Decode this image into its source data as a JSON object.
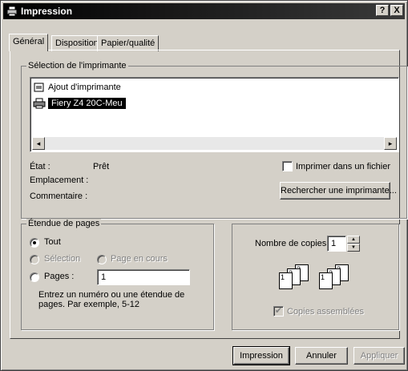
{
  "window": {
    "title": "Impression",
    "help_btn": "?",
    "close_btn": "X"
  },
  "tabs": [
    {
      "label": "Général"
    },
    {
      "label": "Disposition"
    },
    {
      "label": "Papier/qualité"
    }
  ],
  "printer_section": {
    "title": "Sélection de l'imprimante",
    "printers": [
      {
        "name": "Ajout d'imprimante"
      },
      {
        "name": "Fiery Z4 20C-Meu"
      }
    ],
    "status_label": "État :",
    "status_value": "Prêt",
    "location_label": "Emplacement :",
    "comment_label": "Commentaire :",
    "print_to_file_label": "Imprimer dans un fichier",
    "find_printer_label": "Rechercher une imprimante..."
  },
  "page_range": {
    "title": "Étendue de pages",
    "all_label": "Tout",
    "selection_label": "Sélection",
    "current_page_label": "Page en cours",
    "pages_label": "Pages :",
    "pages_value": "1",
    "hint": "Entrez un numéro ou une étendue de pages. Par exemple, 5-12"
  },
  "copies": {
    "count_label": "Nombre de copies :",
    "count_value": "1",
    "collate_label": "Copies assemblées",
    "page_numbers": [
      "1",
      "2",
      "3"
    ]
  },
  "buttons": {
    "print": "Impression",
    "cancel": "Annuler",
    "apply": "Appliquer"
  },
  "icons": {
    "scroll_left": "◂",
    "scroll_right": "▸",
    "spin_up": "▲",
    "spin_down": "▼",
    "check_mark": "✔"
  }
}
